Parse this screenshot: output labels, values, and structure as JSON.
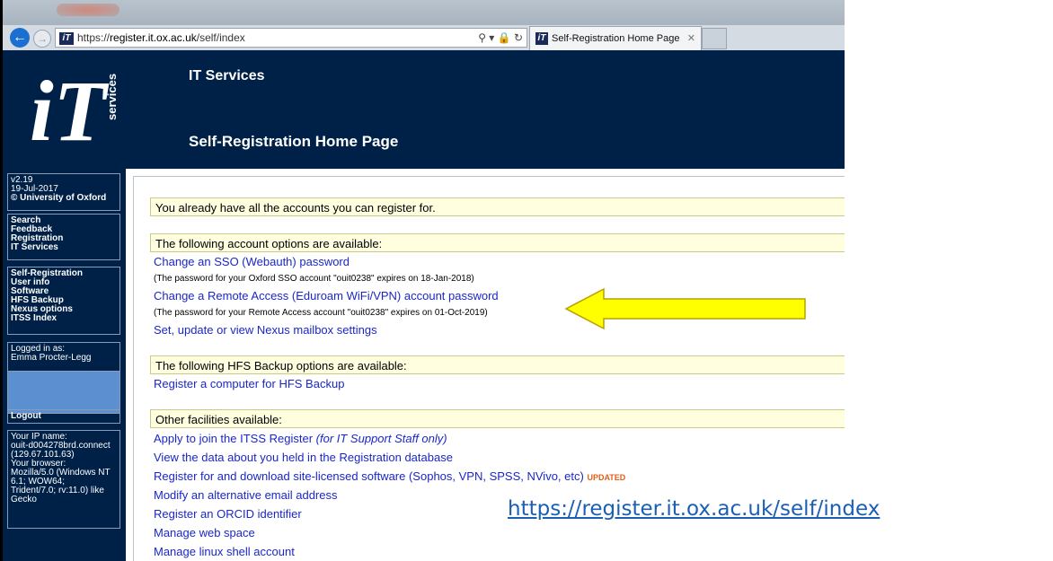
{
  "browser": {
    "url_prefix": "https://",
    "url_domain": "register.it.ox.ac.uk",
    "url_path": "/self/index",
    "tab_title": "Self-Registration Home Page",
    "favicon_text": "iT",
    "address_icons": "⚲ ▾ 🔒 ↻"
  },
  "header": {
    "logo_text": "iT",
    "logo_subtext": "services",
    "site_name": "IT Services",
    "page_title": "Self-Registration Home Page",
    "background": "#002147"
  },
  "sidebar": {
    "version": "v2.19",
    "date": "19-Jul-2017",
    "copyright": "© University of Oxford",
    "nav1": [
      "Search",
      "Feedback",
      "Registration",
      "IT Services"
    ],
    "nav2": [
      "Self-Registration",
      "User info",
      "Software",
      "HFS Backup",
      "Nexus options",
      "ITSS Index"
    ],
    "logged_label": "Logged in as:",
    "logged_user": "Emma Procter-Legg",
    "logout": "Logout",
    "ip_label": "Your IP name:",
    "ip_name": "ouit-d004278brd.connect",
    "ip_addr": "(129.67.101.63)",
    "browser_label": "Your browser:",
    "browser_lines": [
      "Mozilla/5.0 (Windows NT",
      "6.1; WOW64;",
      "Trident/7.0; rv:11.0) like",
      "Gecko"
    ]
  },
  "main": {
    "notice": "You already have all the accounts you can register for.",
    "section1": "The following account options are available:",
    "link_sso": "Change an SSO (Webauth) password",
    "note_sso": "(The password for your Oxford SSO account \"ouit0238\" expires on 18-Jan-2018)",
    "link_remote": "Change a Remote Access (Eduroam WiFi/VPN) account password",
    "note_remote": "(The password for your Remote Access account \"ouit0238\" expires on 01-Oct-2019)",
    "link_nexus": "Set, update or view Nexus mailbox settings",
    "section2": "The following HFS Backup options are available:",
    "link_hfs": "Register a computer for HFS Backup",
    "section3": "Other facilities available:",
    "link_itss": "Apply to join the ITSS Register",
    "link_itss_note": "(for IT Support Staff only)",
    "link_view": "View the data about you held in the Registration database",
    "link_software": "Register for and download site-licensed software (Sophos, VPN, SPSS, NVivo, etc)",
    "updated_badge": "UPDATED",
    "link_email": "Modify an alternative email address",
    "link_orcid": "Register an ORCID identifier",
    "link_web": "Manage web space",
    "link_linux": "Manage linux shell account"
  },
  "overlay": {
    "url_caption": "https://register.it.ox.ac.uk/self/index",
    "arrow_color": "#ffff00"
  }
}
